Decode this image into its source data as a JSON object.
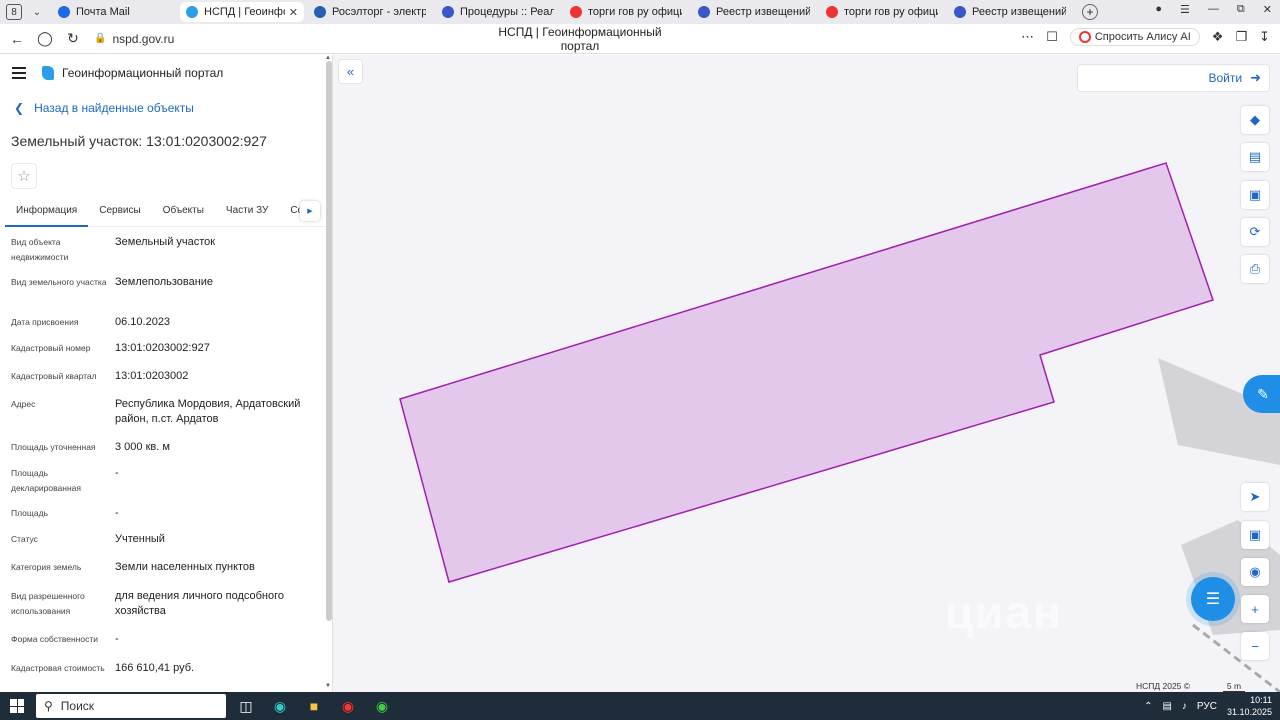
{
  "browser": {
    "tab_counter": "8",
    "tabs": [
      {
        "title": "Почта Mail",
        "color": "#1e6ae6",
        "active": false
      },
      {
        "title": "НСПД | Геоинформац",
        "color": "#2a9ee6",
        "active": true
      },
      {
        "title": "Росэлторг - электронна",
        "color": "#2860b0",
        "active": false
      },
      {
        "title": "Процедуры :: Реализац",
        "color": "#3a56c8",
        "active": false
      },
      {
        "title": "торги гов ру официальн",
        "color": "#e33",
        "active": false
      },
      {
        "title": "Реестр извещений",
        "color": "#3a56c8",
        "active": false
      },
      {
        "title": "торги гов ру официальн",
        "color": "#e33",
        "active": false
      },
      {
        "title": "Реестр извещений",
        "color": "#3a56c8",
        "active": false
      }
    ],
    "url": "nspd.gov.ru",
    "page_title": "НСПД | Геоинформационный портал",
    "alice_label": "Спросить Алису AI"
  },
  "panel": {
    "app_title": "Геоинформационный портал",
    "back_label": "Назад в найденные объекты",
    "object_title": "Земельный участок: 13:01:0203002:927",
    "tabs": [
      "Информация",
      "Сервисы",
      "Объекты",
      "Части ЗУ",
      "Соста"
    ],
    "attributes": [
      {
        "label": "Вид объекта недвижимости",
        "value": "Земельный участок"
      },
      {
        "label": "Вид земельного участка",
        "value": "Землепользование"
      },
      {
        "label": "Дата присвоения",
        "value": "06.10.2023"
      },
      {
        "label": "Кадастровый номер",
        "value": "13:01:0203002:927"
      },
      {
        "label": "Кадастровый квартал",
        "value": "13:01:0203002"
      },
      {
        "label": "Адрес",
        "value": "Республика Мордовия, Ардатовский район, п.ст. Ардатов"
      },
      {
        "label": "Площадь уточненная",
        "value": "3 000 кв. м"
      },
      {
        "label": "Площадь декларированная",
        "value": "-"
      },
      {
        "label": "Площадь",
        "value": "-"
      },
      {
        "label": "Статус",
        "value": "Учтенный"
      },
      {
        "label": "Категория земель",
        "value": "Земли населенных пунктов"
      },
      {
        "label": "Вид разрешенного использования",
        "value": "для ведения личного подсобного хозяйства"
      },
      {
        "label": "Форма собственности",
        "value": "-"
      },
      {
        "label": "Кадастровая стоимость",
        "value": "166 610,41 руб."
      }
    ]
  },
  "map": {
    "login_label": "Войти",
    "copyright": "НСПД 2025 ©",
    "scale_label": "5 m",
    "watermark": "циан",
    "parcel_fill": "#e4c8ec",
    "parcel_stroke": "#a020b0",
    "accent": "#1e67c7"
  },
  "taskbar": {
    "search_label": "Поиск",
    "language": "РУС",
    "time": "10:11",
    "date": "31.10.2025"
  }
}
